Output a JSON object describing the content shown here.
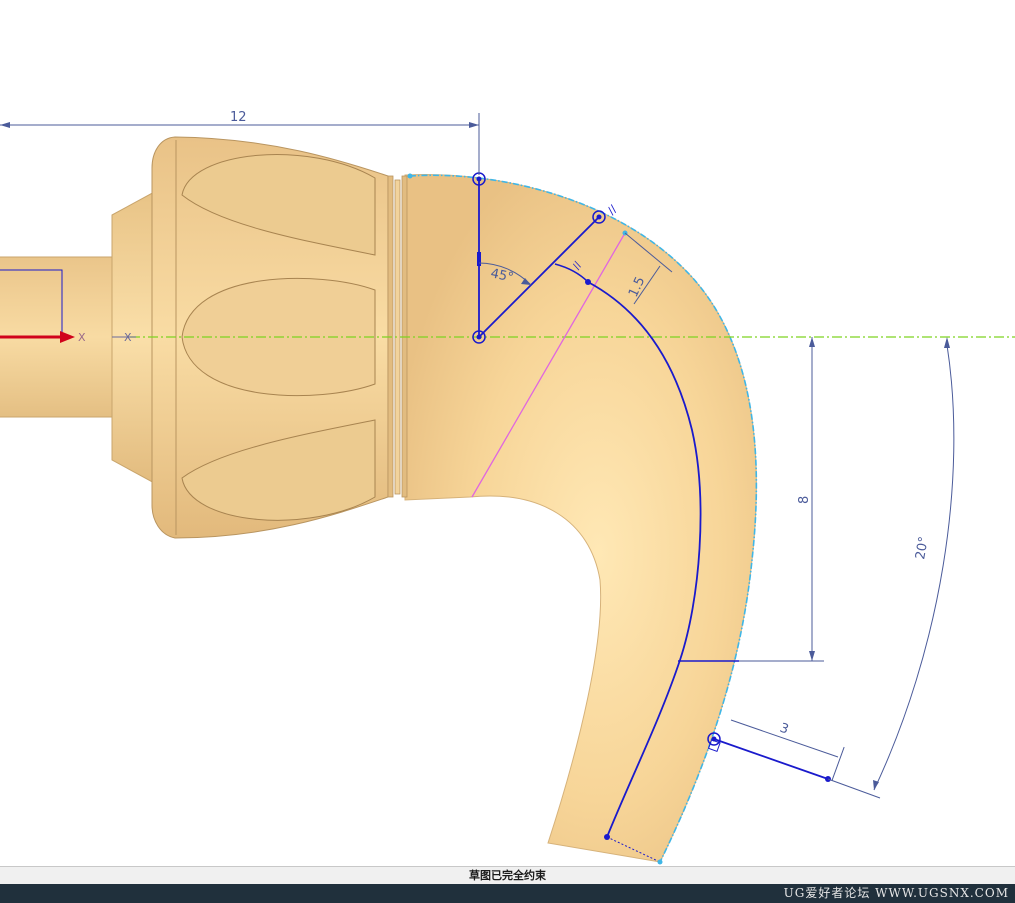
{
  "dimensions": {
    "horizontal_length": "12",
    "angle": "45°",
    "offset": "1.5",
    "vertical_length": "8",
    "arc_angle": "20°",
    "end_offset": "3"
  },
  "axis": {
    "x_label": "X"
  },
  "status": {
    "message": "草图已完全约束"
  },
  "watermark": {
    "text": "UG爱好者论坛 WWW.UGSNX.COM"
  },
  "colors": {
    "body": "#f7d598",
    "sketch_curve": "#1a1acc",
    "dimension": "#4b5b9a",
    "axis_dash": "#7ed321",
    "construction": "#e066e0",
    "edge_highlight": "#3fb6e6"
  }
}
